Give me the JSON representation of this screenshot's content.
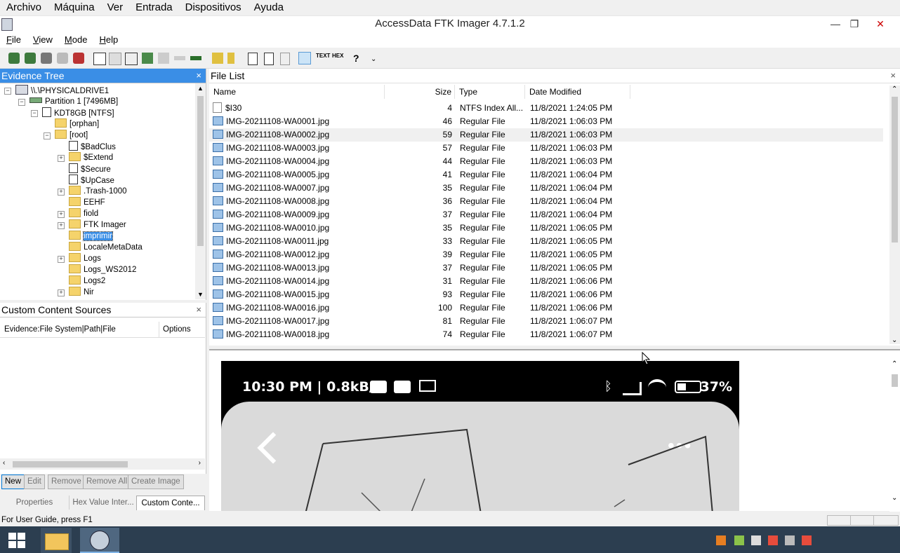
{
  "vm_menu": [
    "Archivo",
    "Máquina",
    "Ver",
    "Entrada",
    "Dispositivos",
    "Ayuda"
  ],
  "window": {
    "title": "AccessData FTK Imager 4.7.1.2",
    "minimize": "—",
    "restore": "❐",
    "close": "✕"
  },
  "app_menu": [
    "File",
    "View",
    "Mode",
    "Help"
  ],
  "evidence_tree": {
    "title": "Evidence Tree",
    "close": "×",
    "drive": "\\\\.\\PHYSICALDRIVE1",
    "partition": "Partition 1 [7496MB]",
    "volume": "KDT8GB [NTFS]",
    "orphan": "[orphan]",
    "root": "[root]",
    "children": [
      "$BadClus",
      "$Extend",
      "$Secure",
      "$UpCase",
      ".Trash-1000",
      "EEHF",
      "fiold",
      "FTK Imager",
      "imprimir",
      "LocaleMetaData",
      "Logs",
      "Logs_WS2012",
      "Logs2",
      "Nir"
    ],
    "selected": "imprimir"
  },
  "custom_sources": {
    "title": "Custom Content Sources",
    "close": "×",
    "col_evidence": "Evidence:File System|Path|File",
    "col_options": "Options"
  },
  "buttons": {
    "new": "New",
    "edit": "Edit",
    "remove": "Remove",
    "remove_all": "Remove All",
    "create_image": "Create Image"
  },
  "tabs": {
    "properties": "Properties",
    "hex": "Hex Value Inter...",
    "custom": "Custom Conte..."
  },
  "file_list": {
    "title": "File List",
    "close": "×",
    "headers": {
      "name": "Name",
      "size": "Size",
      "type": "Type",
      "date": "Date Modified"
    },
    "rows": [
      {
        "name": "$I30",
        "size": "4",
        "type": "NTFS Index All...",
        "date": "11/8/2021 1:24:05 PM"
      },
      {
        "name": "IMG-20211108-WA0001.jpg",
        "size": "46",
        "type": "Regular File",
        "date": "11/8/2021 1:06:03 PM"
      },
      {
        "name": "IMG-20211108-WA0002.jpg",
        "size": "59",
        "type": "Regular File",
        "date": "11/8/2021 1:06:03 PM"
      },
      {
        "name": "IMG-20211108-WA0003.jpg",
        "size": "57",
        "type": "Regular File",
        "date": "11/8/2021 1:06:03 PM"
      },
      {
        "name": "IMG-20211108-WA0004.jpg",
        "size": "44",
        "type": "Regular File",
        "date": "11/8/2021 1:06:03 PM"
      },
      {
        "name": "IMG-20211108-WA0005.jpg",
        "size": "41",
        "type": "Regular File",
        "date": "11/8/2021 1:06:04 PM"
      },
      {
        "name": "IMG-20211108-WA0007.jpg",
        "size": "35",
        "type": "Regular File",
        "date": "11/8/2021 1:06:04 PM"
      },
      {
        "name": "IMG-20211108-WA0008.jpg",
        "size": "36",
        "type": "Regular File",
        "date": "11/8/2021 1:06:04 PM"
      },
      {
        "name": "IMG-20211108-WA0009.jpg",
        "size": "37",
        "type": "Regular File",
        "date": "11/8/2021 1:06:04 PM"
      },
      {
        "name": "IMG-20211108-WA0010.jpg",
        "size": "35",
        "type": "Regular File",
        "date": "11/8/2021 1:06:05 PM"
      },
      {
        "name": "IMG-20211108-WA0011.jpg",
        "size": "33",
        "type": "Regular File",
        "date": "11/8/2021 1:06:05 PM"
      },
      {
        "name": "IMG-20211108-WA0012.jpg",
        "size": "39",
        "type": "Regular File",
        "date": "11/8/2021 1:06:05 PM"
      },
      {
        "name": "IMG-20211108-WA0013.jpg",
        "size": "37",
        "type": "Regular File",
        "date": "11/8/2021 1:06:05 PM"
      },
      {
        "name": "IMG-20211108-WA0014.jpg",
        "size": "31",
        "type": "Regular File",
        "date": "11/8/2021 1:06:06 PM"
      },
      {
        "name": "IMG-20211108-WA0015.jpg",
        "size": "93",
        "type": "Regular File",
        "date": "11/8/2021 1:06:06 PM"
      },
      {
        "name": "IMG-20211108-WA0016.jpg",
        "size": "100",
        "type": "Regular File",
        "date": "11/8/2021 1:06:06 PM"
      },
      {
        "name": "IMG-20211108-WA0017.jpg",
        "size": "81",
        "type": "Regular File",
        "date": "11/8/2021 1:06:07 PM"
      },
      {
        "name": "IMG-20211108-WA0018.jpg",
        "size": "74",
        "type": "Regular File",
        "date": "11/8/2021 1:06:07 PM"
      }
    ]
  },
  "viewer": {
    "status_left": "10:30 PM | 0.8kB/s",
    "battery": "37%"
  },
  "status_bar": "For User Guide, press F1",
  "colors": {
    "accent": "#3a8ee6",
    "taskbar": "#2c3e50"
  }
}
